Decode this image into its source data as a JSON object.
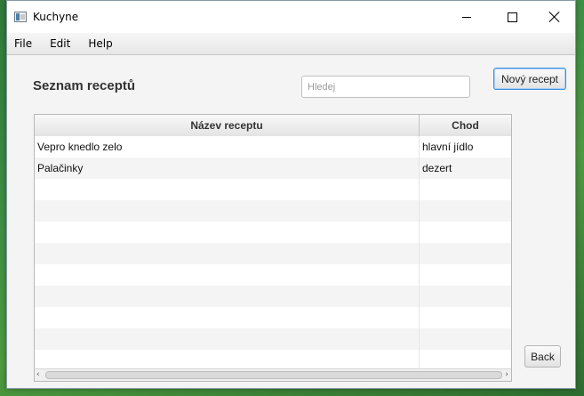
{
  "window": {
    "title": "Kuchyne"
  },
  "menu": [
    "File",
    "Edit",
    "Help"
  ],
  "page": {
    "title": "Seznam receptů"
  },
  "search": {
    "placeholder": "Hledej",
    "value": ""
  },
  "buttons": {
    "new_recipe": "Nový recept",
    "back": "Back"
  },
  "table": {
    "columns": [
      "Název receptu",
      "Chod"
    ],
    "rows": [
      [
        "Vepro knedlo zelo",
        "hlavní jídlo"
      ],
      [
        "Palačinky",
        "dezert"
      ]
    ],
    "empty_rows": 9
  },
  "colors": {
    "desktop": "#3d8f45",
    "accent": "#3c8ee0"
  },
  "icons": {
    "app": "app-window-icon",
    "minimize": "minimize-icon",
    "maximize": "maximize-icon",
    "close": "close-icon",
    "scroll_left": "chevron-left-icon",
    "scroll_right": "chevron-right-icon"
  }
}
